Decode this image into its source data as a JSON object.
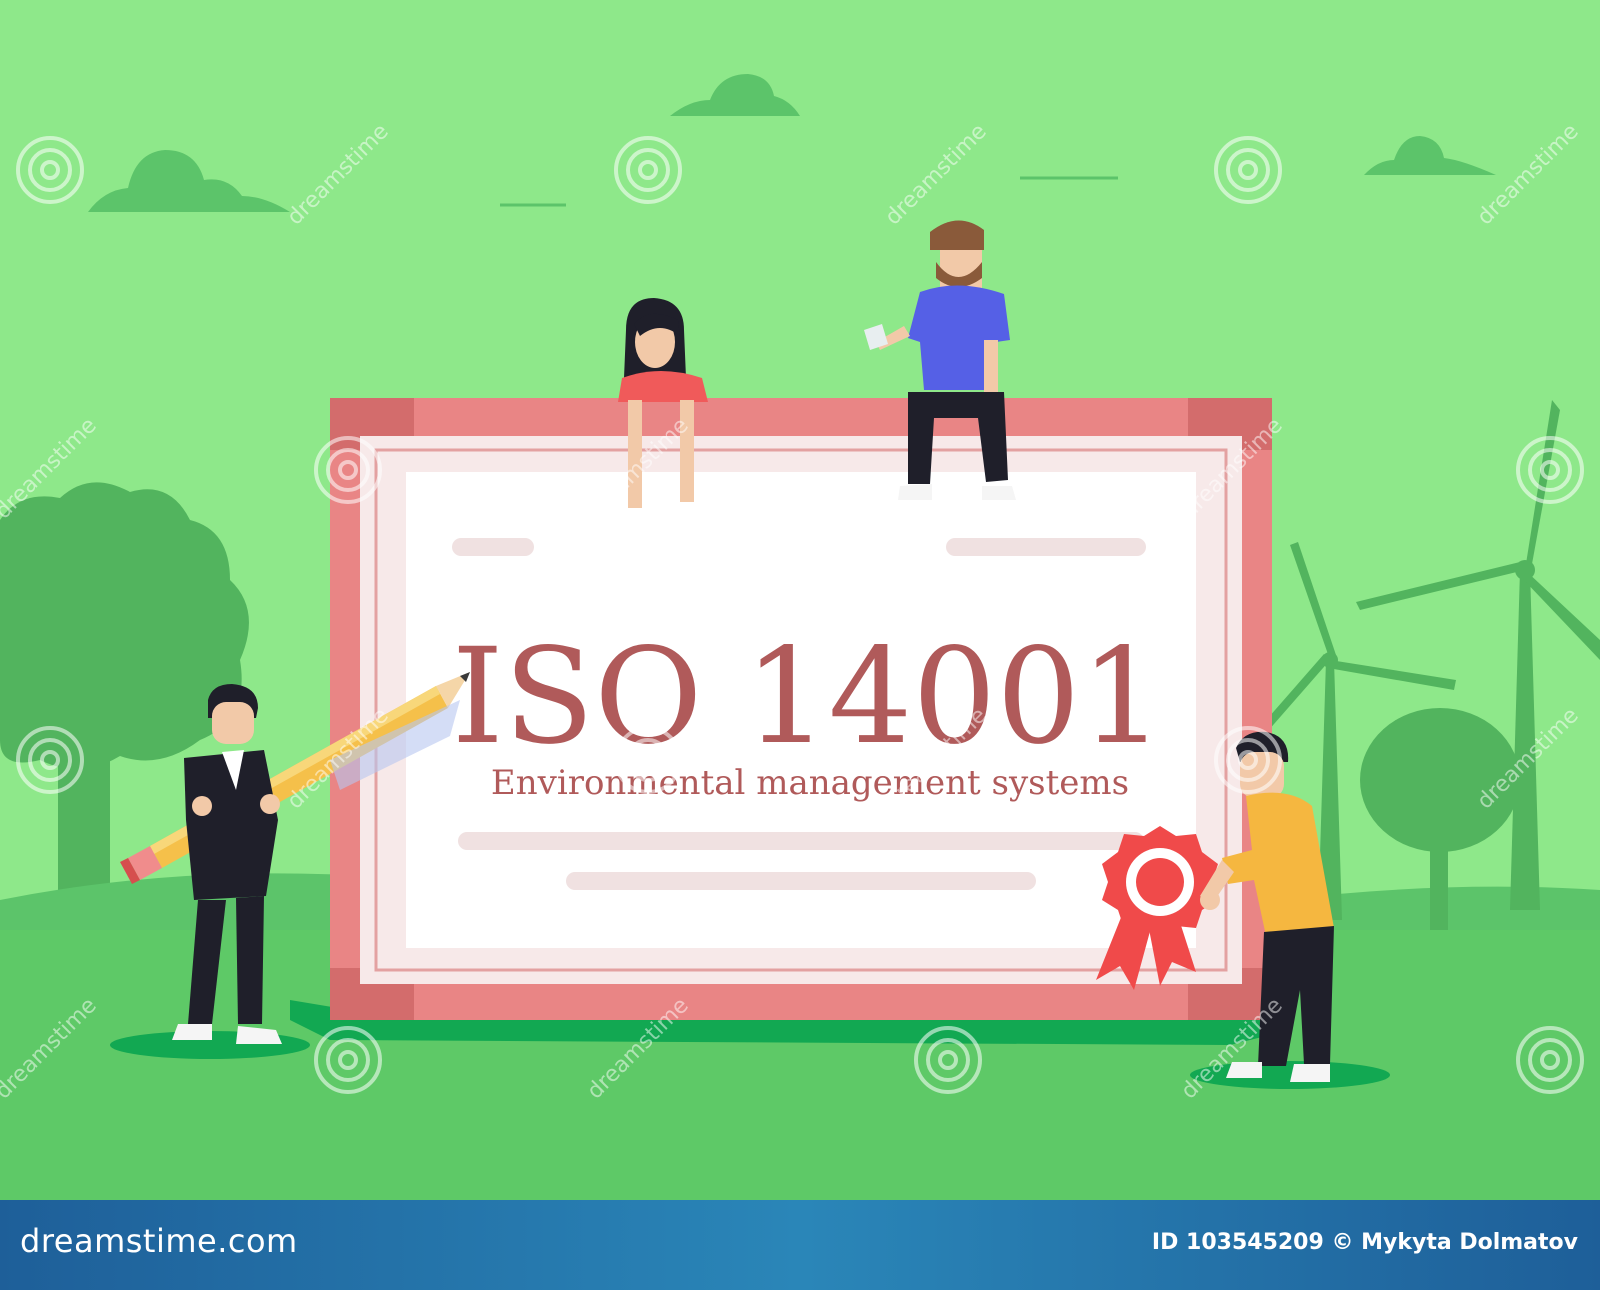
{
  "certificate": {
    "title": "ISO 14001",
    "subtitle": "Environmental management systems"
  },
  "watermark": {
    "text": "dreamstime"
  },
  "footer": {
    "brand": "dreamstime.com",
    "credit": "ID 103545209 © Mykyta Dolmatov"
  },
  "colors": {
    "sky": "#8ee88a",
    "ground": "#5ec967",
    "frame": "#e98585",
    "title_text": "#b05a5a",
    "footer": "#2a86b8"
  }
}
